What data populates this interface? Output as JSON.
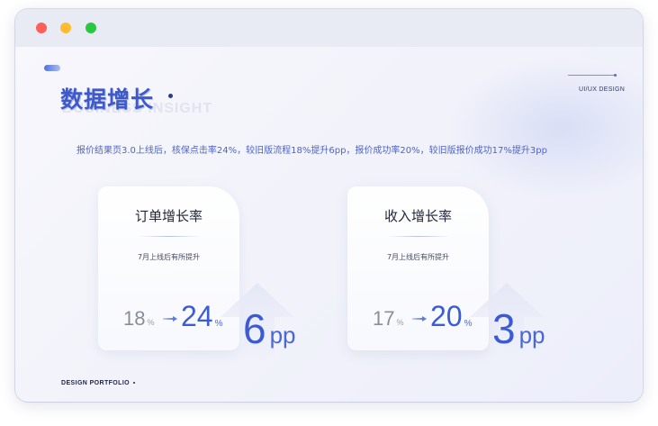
{
  "window": {
    "controls": {
      "close": "red-close-icon",
      "minimize": "yellow-minimize-icon",
      "maximize": "green-maximize-icon"
    }
  },
  "header": {
    "title": "数据增长",
    "title_ghost": "BUSINESS INSIGHT",
    "tag": "UI/UX DESIGN"
  },
  "summary": "报价结果页3.0上线后，核保点击率24%，较旧版流程18%提升6pp，报价成功率20%，较旧版报价成功17%提升3pp",
  "cards": [
    {
      "title": "订单增长率",
      "subtitle": "7月上线后有所提升",
      "old_value": "18",
      "new_value": "24",
      "percent": "%",
      "delta": "6",
      "delta_unit": "pp"
    },
    {
      "title": "收入增长率",
      "subtitle": "7月上线后有所提升",
      "old_value": "17",
      "new_value": "20",
      "percent": "%",
      "delta": "3",
      "delta_unit": "pp"
    }
  ],
  "footer": {
    "label": "DESIGN PORTFOLIO"
  },
  "colors": {
    "accent": "#3b5bd8",
    "muted": "#8a8d99",
    "title_text": "#23263a"
  }
}
